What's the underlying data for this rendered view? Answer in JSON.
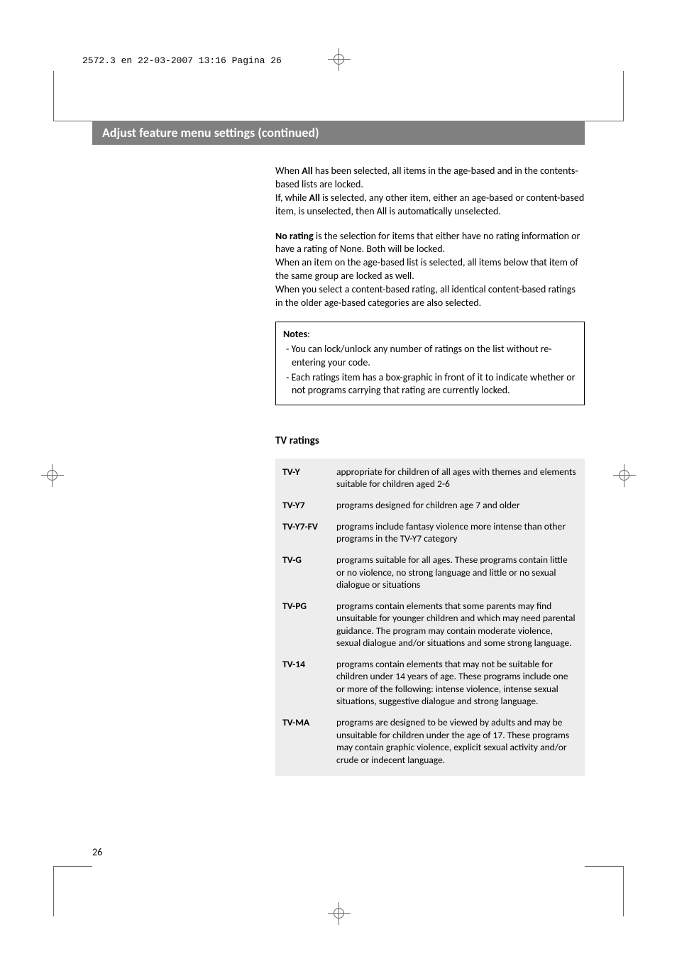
{
  "print": {
    "header": "2572.3 en  22-03-2007  13:16  Pagina 26"
  },
  "title": "Adjust feature menu settings  (continued)",
  "intro": {
    "p1a": "When ",
    "p1b": "All",
    "p1c": " has been selected, all items in the age-based and in the contents-based lists are locked.",
    "p2a": "If, while ",
    "p2b": "All",
    "p2c": " is selected, any other item, either an age-based or content-based item, is unselected, then All is automatically unselected.",
    "p3a": "No rating",
    "p3b": " is the selection for items that either have no rating information or have a rating of None. Both will be locked.",
    "p4": "When an item on the age-based list is selected, all items below that item of the same group are locked as well.",
    "p5": "When you select a content-based rating, all identical content-based ratings in the older age-based categories are also selected."
  },
  "notes": {
    "title": "Notes",
    "items": [
      "- You can lock/unlock any number of ratings on the list without re-entering your code.",
      "- Each ratings item has a box-graphic in front of it to indicate whether or not programs carrying that rating are currently locked."
    ]
  },
  "ratings": {
    "heading": "TV ratings",
    "rows": [
      {
        "label": "TV-Y",
        "desc": "appropriate for children of all ages with themes and elements suitable for children aged 2-6"
      },
      {
        "label": "TV-Y7",
        "desc": "programs designed for children age 7 and older"
      },
      {
        "label": "TV-Y7-FV",
        "desc": "programs include fantasy violence more intense than other programs in the TV-Y7 category"
      },
      {
        "label": "TV-G",
        "desc": "programs suitable for all ages. These programs contain little or no violence, no strong language and little or no sexual dialogue or situations"
      },
      {
        "label": "TV-PG",
        "desc": "programs contain elements that some parents may find unsuitable for younger children and which may need parental guidance. The program may contain moderate violence, sexual dialogue and/or situations and some strong language."
      },
      {
        "label": "TV-14",
        "desc": "programs contain elements that may not be suitable for children under 14 years of age. These programs include one or more of the following: intense violence, intense sexual situations, suggestive dialogue and strong language."
      },
      {
        "label": "TV-MA",
        "desc": "programs are designed to be viewed by adults and may be unsuitable for children under the age of 17. These programs may contain graphic violence, explicit sexual activity and/or crude or indecent language."
      }
    ]
  },
  "pageNumber": "26"
}
